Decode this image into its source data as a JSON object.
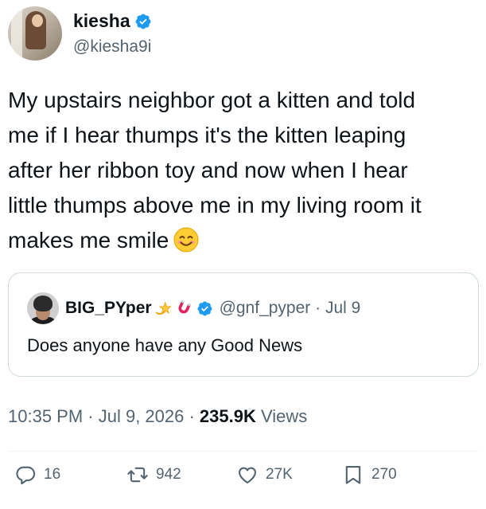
{
  "tweet": {
    "author": {
      "display_name": "kiesha",
      "handle": "@kiesha9i",
      "verified": true
    },
    "text_lines": [
      "My upstairs neighbor got a kitten and told",
      "me if I hear thumps it's the kitten leaping",
      "after her ribbon toy and now when I hear",
      "little thumps above me in my living room it",
      "makes me smile"
    ],
    "text_emoji": "smiling-face-with-smiling-eyes",
    "quote": {
      "display_name": "BIG_PYper",
      "name_emojis": [
        "dizzy-star",
        "magnet"
      ],
      "verified": true,
      "handle_date": "@gnf_pyper · Jul 9",
      "text": "Does anyone have any Good News"
    },
    "timestamp": "10:35 PM · Jul 9, 2026 · ",
    "views_count": "235.9K",
    "views_label": " Views",
    "actions": {
      "replies": "16",
      "reposts": "942",
      "likes": "27K",
      "bookmarks": "270"
    },
    "colors": {
      "verified_blue": "#1d9bf0",
      "text_primary": "#0f1419",
      "text_secondary": "#536471",
      "border": "#cfd9de"
    }
  }
}
